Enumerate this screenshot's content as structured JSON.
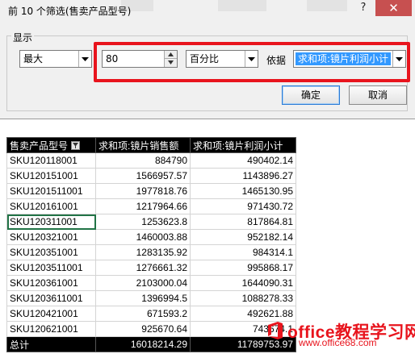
{
  "dialog": {
    "title": "前 10 个筛选(售卖产品型号)",
    "help_label": "?",
    "close_label": "✕",
    "group_label": "显示",
    "top_bottom_value": "最大",
    "count_value": "80",
    "unit_value": "百分比",
    "by_label": "依据",
    "field_value": "求和项:镜片利润小计",
    "ok_label": "确定",
    "cancel_label": "取消",
    "highlight_color": "#e8141d"
  },
  "sheet": {
    "columns": [
      "售卖产品型号",
      "求和项:镜片销售额",
      "求和项:镜片利润小计"
    ],
    "rows": [
      {
        "sku": "SKU120118001",
        "sales": "884790",
        "profit": "490402.14"
      },
      {
        "sku": "SKU120151001",
        "sales": "1566957.57",
        "profit": "1143896.27"
      },
      {
        "sku": "SKU1201511001",
        "sales": "1977818.76",
        "profit": "1465130.95"
      },
      {
        "sku": "SKU120161001",
        "sales": "1217964.66",
        "profit": "971430.72"
      },
      {
        "sku": "SKU120311001",
        "sales": "1253623.8",
        "profit": "817864.81"
      },
      {
        "sku": "SKU120321001",
        "sales": "1460003.88",
        "profit": "952182.14"
      },
      {
        "sku": "SKU120351001",
        "sales": "1283135.92",
        "profit": "984314.1"
      },
      {
        "sku": "SKU1203511001",
        "sales": "1276661.32",
        "profit": "995868.17"
      },
      {
        "sku": "SKU120361001",
        "sales": "2103000.04",
        "profit": "1644090.31"
      },
      {
        "sku": "SKU1203611001",
        "sales": "1396994.5",
        "profit": "1088278.33"
      },
      {
        "sku": "SKU120421001",
        "sales": "671593.2",
        "profit": "492621.88"
      },
      {
        "sku": "SKU120621001",
        "sales": "925670.64",
        "profit": "743674.1"
      }
    ],
    "total": {
      "label": "总计",
      "sales": "16018214.29",
      "profit": "11789753.97"
    },
    "selected_cell": "SKU120311001"
  },
  "watermark": {
    "line1": "office教程学习网",
    "line2": "www.office68.com",
    "color": "#e8141d"
  }
}
